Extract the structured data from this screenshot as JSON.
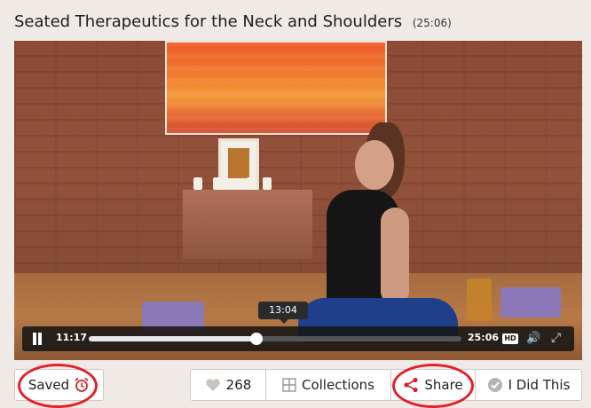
{
  "video": {
    "title": "Seated Therapeutics for the Neck and Shoulders",
    "duration_label": "(25:06)",
    "tooltip_time": "13:04",
    "current_time": "11:17",
    "total_time": "25:06",
    "progress_fraction": 0.45,
    "hd_label": "HD"
  },
  "actions": {
    "saved_label": "Saved",
    "likes_count": "268",
    "collections_label": "Collections",
    "share_label": "Share",
    "did_this_label": "I Did This"
  },
  "icons": {
    "saved": "alarm-clock-icon",
    "like": "heart-icon",
    "collections": "grid-icon",
    "share": "share-icon",
    "did_this": "check-circle-icon",
    "pause": "pause-icon",
    "volume": "volume-icon",
    "fullscreen": "fullscreen-icon"
  },
  "colors": {
    "highlight_ring": "#e4202a",
    "page_background": "#efeae5",
    "share_icon": "#d4262e"
  }
}
